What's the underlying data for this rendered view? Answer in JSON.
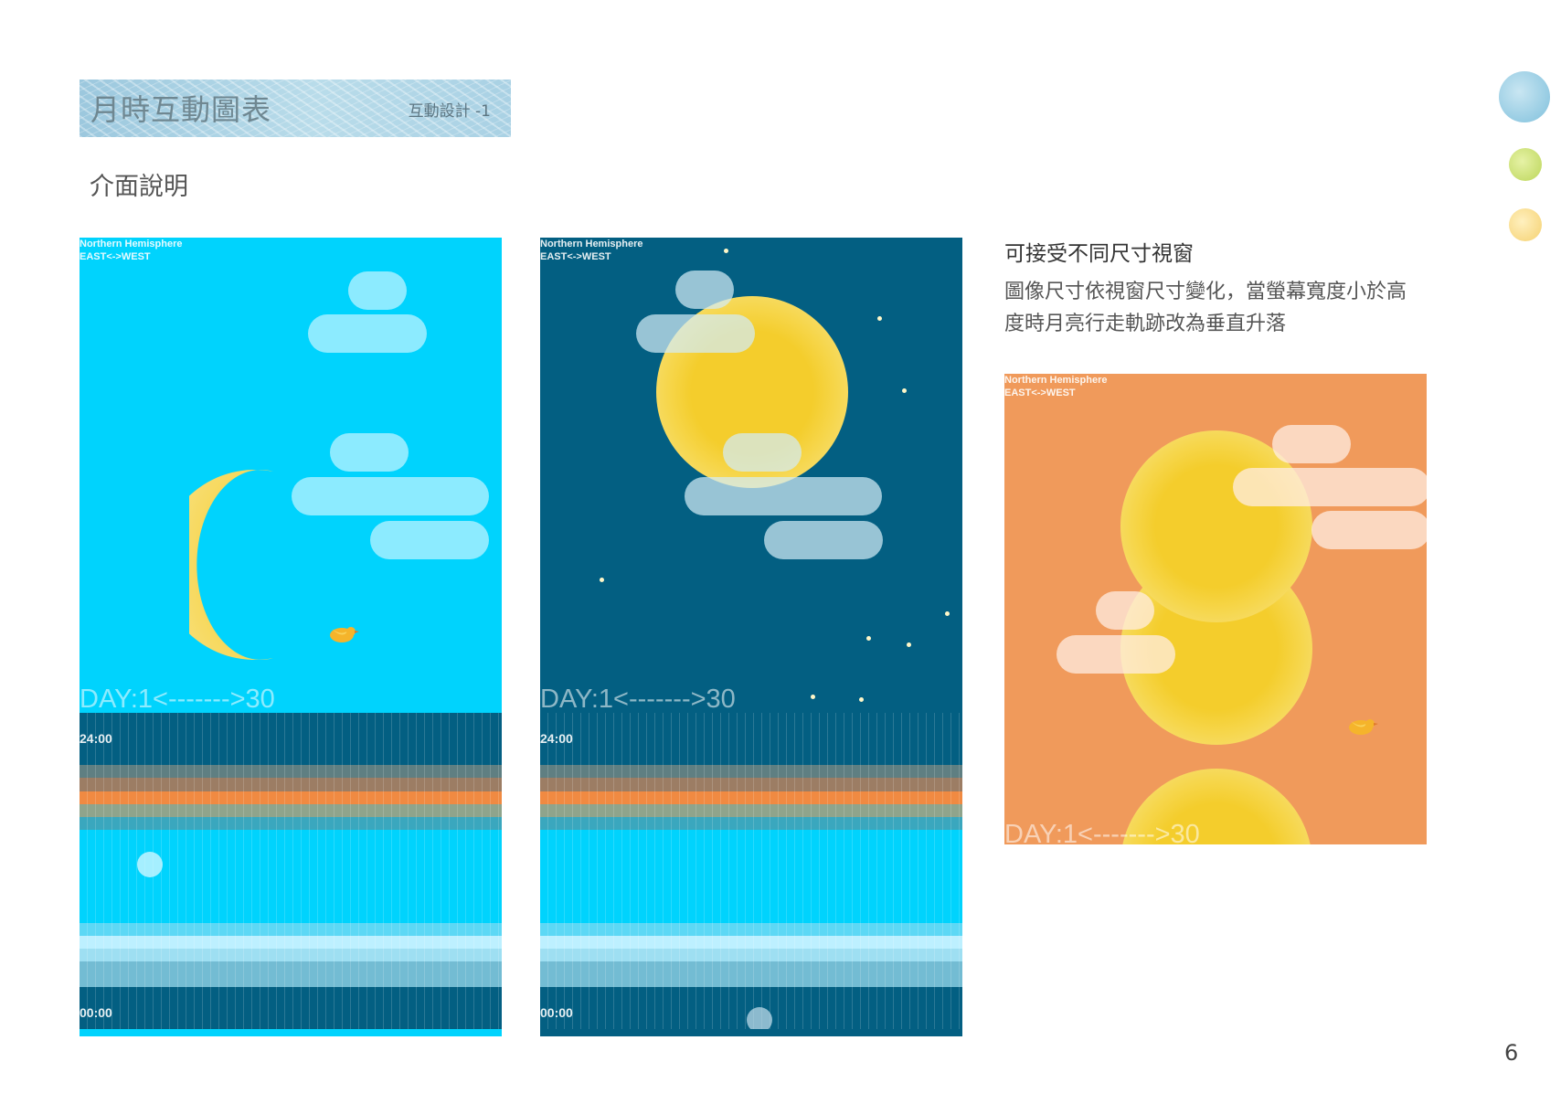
{
  "header": {
    "title": "月時互動圖表",
    "subtitle": "互動設計 -1"
  },
  "section": {
    "title": "介面說明"
  },
  "panels": {
    "hemisphere_line1": "Northern Hemisphere",
    "hemisphere_line2": "EAST<->WEST",
    "day_label": "DAY:1<------->30",
    "time_top": "24:00",
    "time_bottom": "00:00"
  },
  "right": {
    "title": "可接受不同尺寸視窗",
    "description": "圖像尺寸依視窗尺寸變化，當螢幕寬度小於高度時月亮行走軌跡改為垂直升落"
  },
  "colors": {
    "day_sky": "#00d3fd",
    "night_sky": "#035f82",
    "orange_sky": "#f09a5b",
    "moon": "#f4cd2c",
    "time_band_orange": "#f08a42"
  },
  "page_number": "6"
}
